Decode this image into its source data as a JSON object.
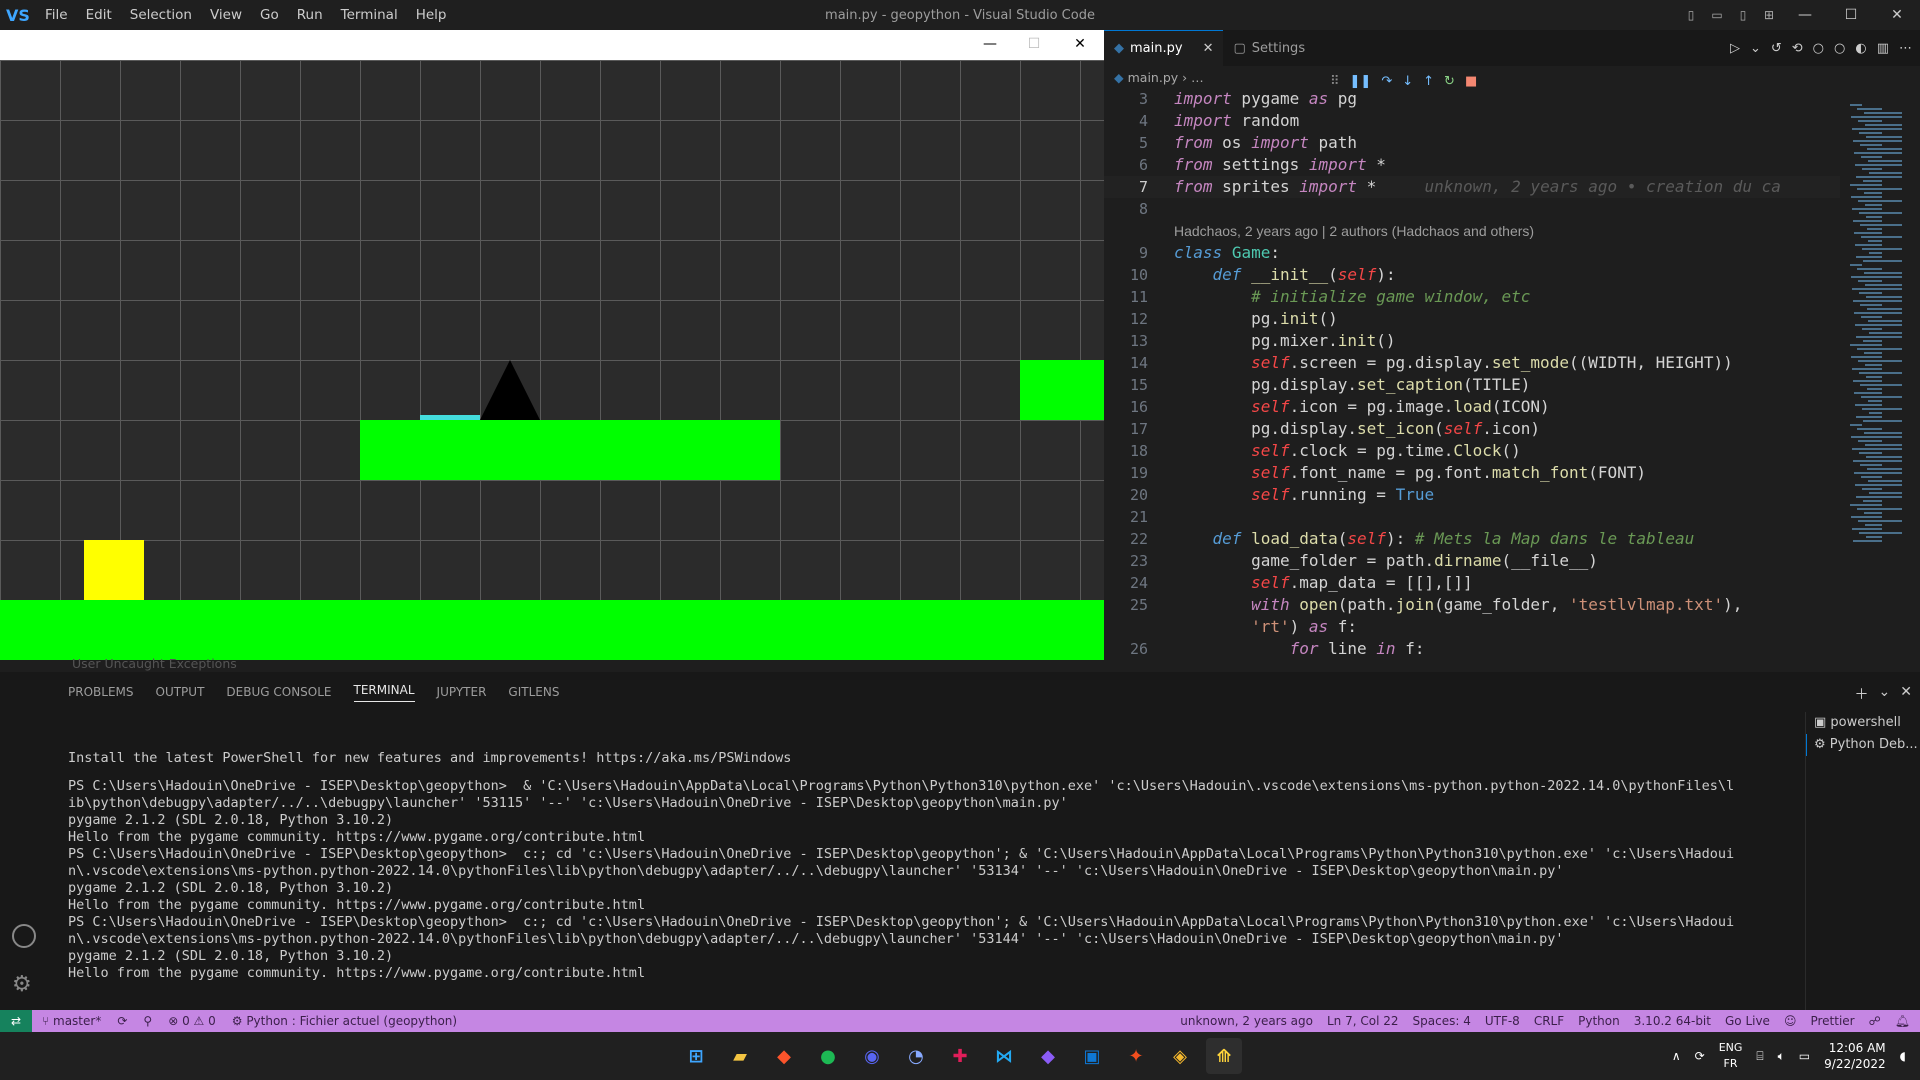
{
  "titlebar": {
    "logo": "VS",
    "menu": [
      "File",
      "Edit",
      "Selection",
      "View",
      "Go",
      "Run",
      "Terminal",
      "Help"
    ],
    "window_title": "main.py - geopython - Visual Studio Code",
    "minimize": "—",
    "maximize": "☐",
    "close": "✕"
  },
  "game_window": {
    "minimize": "—",
    "maximize": "☐",
    "close": "✕",
    "colors": {
      "ground": "#00ff00",
      "player": "#ffff00",
      "spike": "#000000",
      "pad": "#44dddd",
      "background": "#2b2b2b"
    }
  },
  "editor": {
    "tabs": [
      {
        "label": "main.py",
        "close": "✕"
      },
      {
        "label": "Settings"
      }
    ],
    "breadcrumb": [
      "main.py",
      "…"
    ],
    "blame_inline": "unknown, 2 years ago • creation du ca",
    "codelens": "Hadchaos, 2 years ago | 2 authors (Hadchaos and others)"
  },
  "panel": {
    "breakpoint_label": "User Uncaught Exceptions",
    "tabs": [
      "PROBLEMS",
      "OUTPUT",
      "DEBUG CONSOLE",
      "TERMINAL",
      "JUPYTER",
      "GITLENS"
    ],
    "terminals": [
      "powershell",
      "Python Deb..."
    ],
    "terminal_lines": [
      "Install the latest PowerShell for new features and improvements! https://aka.ms/PSWindows",
      "PS C:\\Users\\Hadouin\\OneDrive - ISEP\\Desktop\\geopython>  & 'C:\\Users\\Hadouin\\AppData\\Local\\Programs\\Python\\Python310\\python.exe' 'c:\\Users\\Hadouin\\.vscode\\extensions\\ms-python.python-2022.14.0\\pythonFiles\\l",
      "ib\\python\\debugpy\\adapter/../..\\debugpy\\launcher' '53115' '--' 'c:\\Users\\Hadouin\\OneDrive - ISEP\\Desktop\\geopython\\main.py'",
      "pygame 2.1.2 (SDL 2.0.18, Python 3.10.2)",
      "Hello from the pygame community. https://www.pygame.org/contribute.html",
      "PS C:\\Users\\Hadouin\\OneDrive - ISEP\\Desktop\\geopython>  c:; cd 'c:\\Users\\Hadouin\\OneDrive - ISEP\\Desktop\\geopython'; & 'C:\\Users\\Hadouin\\AppData\\Local\\Programs\\Python\\Python310\\python.exe' 'c:\\Users\\Hadoui",
      "n\\.vscode\\extensions\\ms-python.python-2022.14.0\\pythonFiles\\lib\\python\\debugpy\\adapter/../..\\debugpy\\launcher' '53134' '--' 'c:\\Users\\Hadouin\\OneDrive - ISEP\\Desktop\\geopython\\main.py'",
      "pygame 2.1.2 (SDL 2.0.18, Python 3.10.2)",
      "Hello from the pygame community. https://www.pygame.org/contribute.html",
      "PS C:\\Users\\Hadouin\\OneDrive - ISEP\\Desktop\\geopython>  c:; cd 'c:\\Users\\Hadouin\\OneDrive - ISEP\\Desktop\\geopython'; & 'C:\\Users\\Hadouin\\AppData\\Local\\Programs\\Python\\Python310\\python.exe' 'c:\\Users\\Hadoui",
      "n\\.vscode\\extensions\\ms-python.python-2022.14.0\\pythonFiles\\lib\\python\\debugpy\\adapter/../..\\debugpy\\launcher' '53144' '--' 'c:\\Users\\Hadouin\\OneDrive - ISEP\\Desktop\\geopython\\main.py'",
      "pygame 2.1.2 (SDL 2.0.18, Python 3.10.2)",
      "Hello from the pygame community. https://www.pygame.org/contribute.html"
    ]
  },
  "statusbar": {
    "remote": "⇄",
    "branch": "master*",
    "errors": "⊗ 0 ⚠ 0",
    "interpreter": "Python : Fichier actuel (geopython)",
    "blame": "unknown, 2 years ago",
    "position": "Ln 7, Col 22",
    "spaces": "Spaces: 4",
    "encoding": "UTF-8",
    "eol": "CRLF",
    "language": "Python",
    "version": "3.10.2 64-bit",
    "golive": "Go Live",
    "prettier": "Prettier"
  },
  "taskbar": {
    "lang1": "ENG",
    "lang2": "FR",
    "time": "12:06 AM",
    "date": "9/22/2022"
  }
}
